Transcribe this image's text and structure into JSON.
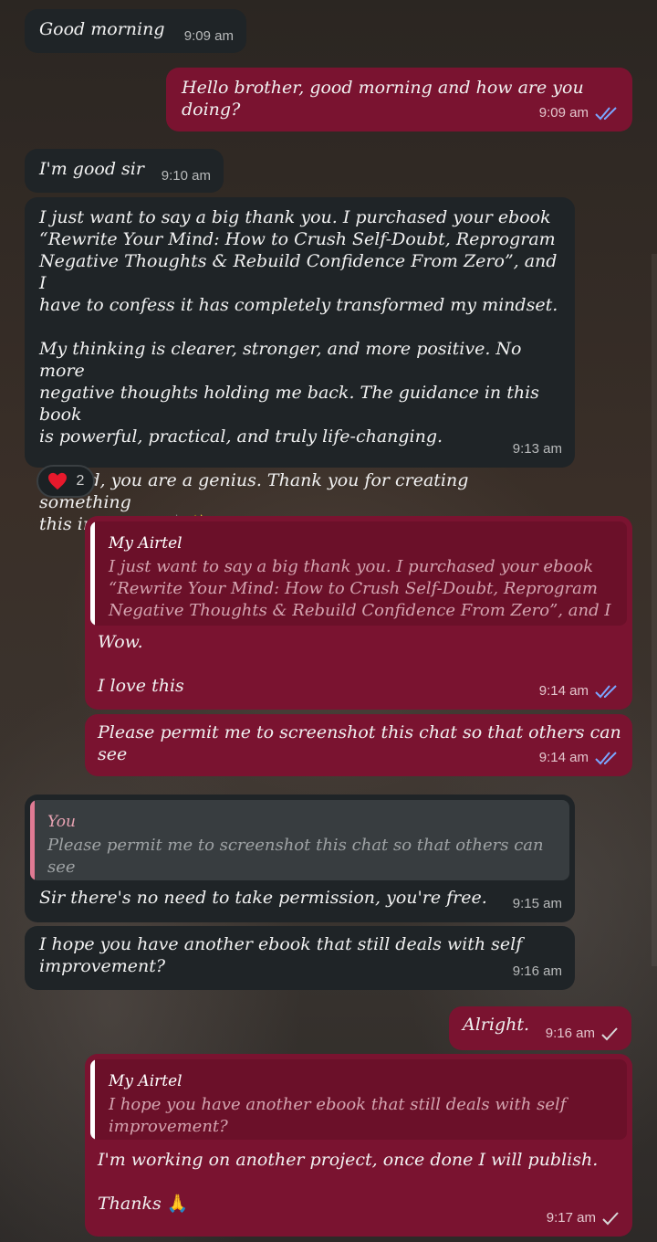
{
  "colors": {
    "incoming_bubble": "#1f2427",
    "outgoing_bubble": "#7a1330",
    "read_tick": "#7aa6ff",
    "sent_tick": "#d8d8d8"
  },
  "messages": [
    {
      "text": "Good morning",
      "time": "9:09 am"
    },
    {
      "text": "Hello brother, good morning and how are you doing?",
      "time": "9:09 am",
      "status": "read"
    },
    {
      "text": "I'm good sir",
      "time": "9:10 am"
    },
    {
      "text": "I just want to say a big thank you. I purchased your ebook\n“Rewrite Your Mind: How to Crush Self-Doubt, Reprogram\nNegative Thoughts & Rebuild Confidence From Zero”, and I\nhave to confess it has completely transformed my mindset.\n\nMy thinking is clearer, stronger, and more positive. No more\nnegative thoughts holding me back. The guidance in this book\nis powerful, practical, and truly life-changing.\n\nIndeed, you are a genius. Thank you for creating something\nthis impactful.",
      "emoji": "🙌✨",
      "time": "9:13 am",
      "reaction_icon": "heart-icon",
      "reaction_count": "2"
    },
    {
      "quote_name": "My Airtel",
      "quote_text": "I just want to say a big thank you. I purchased your ebook\n“Rewrite Your Mind: How to Crush Self-Doubt, Reprogram\nNegative Thoughts & Rebuild Confidence From Zero”, and I ...",
      "text": "Wow.\n\nI love this",
      "time": "9:14 am",
      "status": "read"
    },
    {
      "text": "Please permit me to screenshot this chat so that others can\nsee",
      "time": "9:14 am",
      "status": "read"
    },
    {
      "quote_name": "You",
      "quote_text": "Please permit me to screenshot this chat so that others can\nsee",
      "text": "Sir there's no need to take permission, you're free.",
      "time": "9:15 am"
    },
    {
      "text": "I hope you have another ebook that still deals with self\nimprovement?",
      "time": "9:16 am"
    },
    {
      "text": "Alright.",
      "time": "9:16 am",
      "status": "sent"
    },
    {
      "quote_name": "My Airtel",
      "quote_text": "I hope you have another ebook that still deals with self\nimprovement?",
      "text": "I'm working on another project, once done I will publish.\n\nThanks",
      "emoji": "🙏",
      "time": "9:17 am",
      "status": "sent"
    }
  ]
}
